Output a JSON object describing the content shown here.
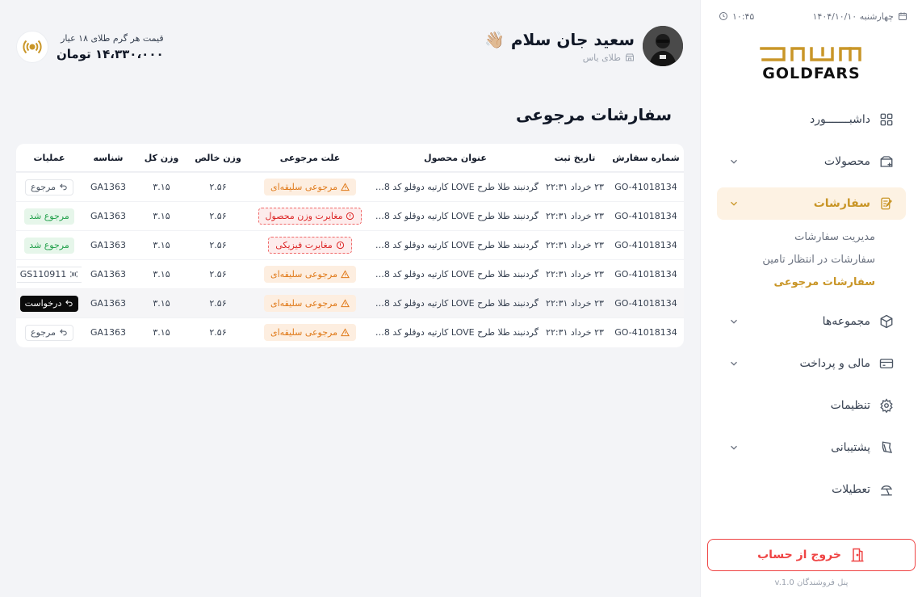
{
  "topbar": {
    "date": "چهارشنبه ۱۴۰۴/۱۰/۱۰",
    "time": "۱۰:۴۵"
  },
  "brand": {
    "logo_text": "GOLDFARS",
    "gold": "#c99628"
  },
  "nav": {
    "items": [
      {
        "label": "داشبـــــــورد",
        "icon": "dashboard-icon"
      },
      {
        "label": "محصولات",
        "icon": "package-plus-icon"
      },
      {
        "label": "سفارشات",
        "icon": "orders-edit-icon"
      },
      {
        "label": "مجموعه‌ها",
        "icon": "cube-icon"
      },
      {
        "label": "مالی و پرداخت",
        "icon": "card-icon"
      },
      {
        "label": "تنظیمات",
        "icon": "gear-icon"
      },
      {
        "label": "پشتیبانی",
        "icon": "support-icon"
      },
      {
        "label": "تعطیلات",
        "icon": "beach-icon"
      }
    ],
    "orders_sub": [
      "مدیریت سفارشات",
      "سفارشات در انتظار تامین",
      "سفارشات مرجوعی"
    ]
  },
  "logout_label": "خروج از حساب",
  "version": "پنل فروشندگان v.1.0",
  "user": {
    "greeting": "سعید جان سلام",
    "emoji": "👋🏼",
    "shop": "طلای یاس"
  },
  "price": {
    "label": "قیمت هر گرم طلای ۱۸ عیار",
    "value": "۱۴،۳۳۰،۰۰۰ تومان"
  },
  "page_title": "سفارشات مرجوعی",
  "table": {
    "headers": {
      "order": "شماره سفارش",
      "date": "تاریخ ثبت",
      "title": "عنوان محصول",
      "reason": "علت مرجوعی",
      "net": "وزن خالص",
      "total": "وزن کل",
      "id": "شناسه",
      "actions": "عملیات"
    },
    "rows": [
      {
        "order": "GO-41018134",
        "date": "۲۳ خرداد ۲۲:۳۱",
        "title": "گردنبند طلا طرح LOVE کارتیه دوقلو کد CN48...",
        "reason": "مرجوعی سلیقه‌ای",
        "net": "۲.۵۶",
        "total": "۳.۱۵",
        "id": "GA1363",
        "action": "مرجوع"
      },
      {
        "order": "GO-41018134",
        "date": "۲۳ خرداد ۲۲:۳۱",
        "title": "گردنبند طلا طرح LOVE کارتیه دوقلو کد CN48...",
        "reason": "مغایرت وزن محصول",
        "net": "۲.۵۶",
        "total": "۳.۱۵",
        "id": "GA1363",
        "action": "مرجوع شد"
      },
      {
        "order": "GO-41018134",
        "date": "۲۳ خرداد ۲۲:۳۱",
        "title": "گردنبند طلا طرح LOVE کارتیه دوقلو کد CN48...",
        "reason": "مغایرت فیزیکی",
        "net": "۲.۵۶",
        "total": "۳.۱۵",
        "id": "GA1363",
        "action": "مرجوع شد"
      },
      {
        "order": "GO-41018134",
        "date": "۲۳ خرداد ۲۲:۳۱",
        "title": "گردنبند طلا طرح LOVE کارتیه دوقلو کد CN48...",
        "reason": "مرجوعی سلیقه‌ای",
        "net": "۲.۵۶",
        "total": "۳.۱۵",
        "id": "GA1363",
        "action": "GS110911"
      },
      {
        "order": "GO-41018134",
        "date": "۲۳ خرداد ۲۲:۳۱",
        "title": "گردنبند طلا طرح LOVE کارتیه دوقلو کد CN48...",
        "reason": "مرجوعی سلیقه‌ای",
        "net": "۲.۵۶",
        "total": "۳.۱۵",
        "id": "GA1363",
        "action": "درخواست"
      },
      {
        "order": "GO-41018134",
        "date": "۲۳ خرداد ۲۲:۳۱",
        "title": "گردنبند طلا طرح LOVE کارتیه دوقلو کد CN48...",
        "reason": "مرجوعی سلیقه‌ای",
        "net": "۲.۵۶",
        "total": "۳.۱۵",
        "id": "GA1363",
        "action": "مرجوع"
      }
    ]
  }
}
